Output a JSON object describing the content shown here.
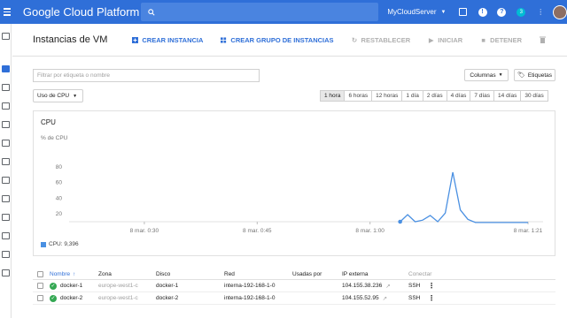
{
  "topbar": {
    "brand": "Google Cloud Platform",
    "search_placeholder": "",
    "project": "MyCloudServer",
    "help_icon_label": "?",
    "notifications_count": "3"
  },
  "header": {
    "title": "Instancias de VM",
    "buttons": {
      "create_instance": "CREAR INSTANCIA",
      "create_group": "CREAR GRUPO DE INSTANCIAS",
      "reset": "RESTABLECER",
      "start": "INICIAR",
      "stop": "DETENER"
    }
  },
  "filter": {
    "placeholder": "Filtrar por etiqueta o nombre"
  },
  "columns_button": "Columnas",
  "tags_button": "Etiquetas",
  "metric_select": "Uso de CPU",
  "time_ranges": [
    "1 hora",
    "6 horas",
    "12 horas",
    "1 día",
    "2 días",
    "4 días",
    "7 días",
    "14 días",
    "30 días"
  ],
  "time_range_selected": "1 hora",
  "chart_data": {
    "type": "line",
    "title": "CPU",
    "ylabel": "% de CPU",
    "yticks": [
      20,
      40,
      60,
      80
    ],
    "ylim": [
      10,
      100
    ],
    "xticks": [
      "8 mar. 0:30",
      "8 mar. 0:45",
      "8 mar. 1:00",
      "8 mar. 1:21"
    ],
    "series": [
      {
        "name": "CPU: 9,396",
        "color": "#4a90e2",
        "x": [
          "1:04",
          "1:05",
          "1:06",
          "1:07",
          "1:08",
          "1:09",
          "1:10",
          "1:11",
          "1:12",
          "1:13",
          "1:14",
          "1:16",
          "1:18",
          "1:20",
          "1:21"
        ],
        "values": [
          10,
          19,
          10,
          12,
          18,
          10,
          21,
          73,
          25,
          13,
          9,
          9,
          9,
          9,
          9
        ]
      }
    ],
    "legend": "CPU: 9,396",
    "grid": false
  },
  "table": {
    "headers": {
      "name": "Nombre",
      "zone": "Zona",
      "disk": "Disco",
      "network": "Red",
      "used_by": "Usadas por",
      "external_ip": "IP externa",
      "connect": "Conectar"
    },
    "rows": [
      {
        "name": "docker-1",
        "zone": "europe-west1-c",
        "disk": "docker-1",
        "network": "interna-192-168-1-0",
        "used_by": "",
        "external_ip": "104.155.38.236",
        "connect": "SSH"
      },
      {
        "name": "docker-2",
        "zone": "europe-west1-c",
        "disk": "docker-2",
        "network": "interna-192-168-1-0",
        "used_by": "",
        "external_ip": "104.155.52.95",
        "connect": "SSH"
      }
    ]
  }
}
